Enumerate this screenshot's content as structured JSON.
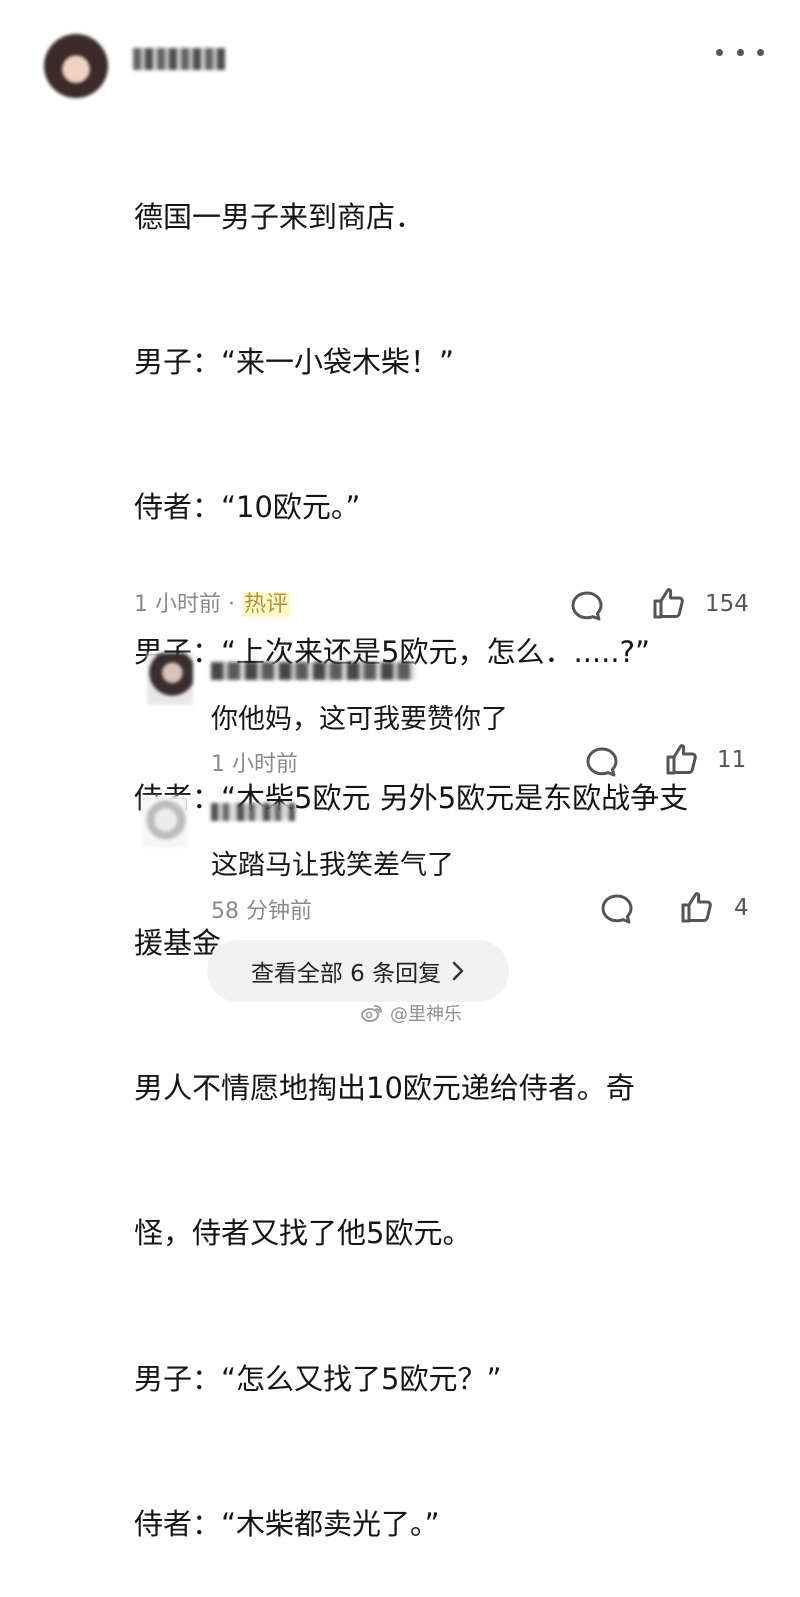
{
  "main_comment": {
    "text_lines": [
      "德国一男子来到商店．",
      "男子：“来一小袋木柴！”",
      "侍者：“10欧元。”",
      "男子：“上次来还是5欧元，怎么．.....?”",
      "侍者：“木柴5欧元 另外5欧元是东欧战争支",
      "援基金。",
      "男人不情愿地掏出10欧元递给侍者。奇",
      "怪，侍者又找了他5欧元。",
      "男子：“怎么又找了5欧元？”",
      "侍者：“木柴都卖光了。”"
    ],
    "time": "1 小时前",
    "separator": "·",
    "hot_tag": "热评",
    "like_count": "154"
  },
  "replies": [
    {
      "text": "你他妈，这可我要赞你了",
      "time": "1 小时前",
      "like_count": "11"
    },
    {
      "text": "这踏马让我笑差气了",
      "time": "58 分钟前",
      "like_count": "4"
    }
  ],
  "footer": {
    "view_all_label": "查看全部 6 条回复",
    "watermark_text": "@里神乐"
  },
  "icons": {
    "more": "more-icon",
    "comment": "comment-icon",
    "like": "like-icon",
    "chevron": "chevron-right-icon",
    "weibo": "weibo-icon"
  }
}
